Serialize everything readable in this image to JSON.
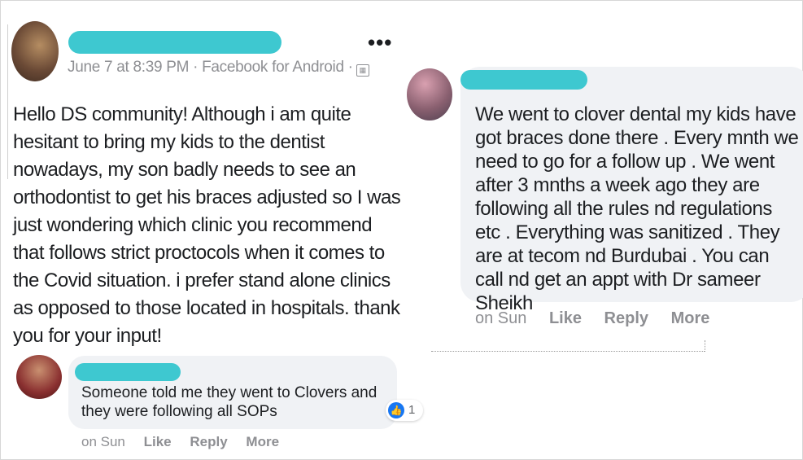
{
  "post": {
    "meta": "June 7 at 8:39 PM · Facebook for Android ·",
    "menu_glyph": "•••",
    "body": "Hello DS community! Although i am quite hesitant to bring my kids to the dentist nowadays, my son badly needs to see an orthodontist to get his braces adjusted so I was just wondering which clinic you recommend that follows strict proctocols when it comes to the Covid situation. i prefer stand alone clinics as opposed to those located in hospitals. thank you for your input!"
  },
  "comment_left": {
    "text": "Someone told me they went to Clovers and they were following all SOPs",
    "reaction_count": "1",
    "time": "on Sun",
    "like": "Like",
    "reply": "Reply",
    "more": "More"
  },
  "comment_right": {
    "text": "We went to clover dental my kids have got braces done there . Every mnth we need to go for a follow up . We went after 3 mnths a week ago they are following all the rules nd regulations etc . Everything was sanitized . They are at tecom nd Burdubai . You can call nd get an appt with Dr sameer Sheikh",
    "time": "on Sun",
    "like": "Like",
    "reply": "Reply",
    "more": "More"
  },
  "colors": {
    "redaction": "#3ec8d0",
    "bubble": "#f0f2f5",
    "meta_text": "#8e8f93",
    "like_blue": "#1877f2"
  }
}
